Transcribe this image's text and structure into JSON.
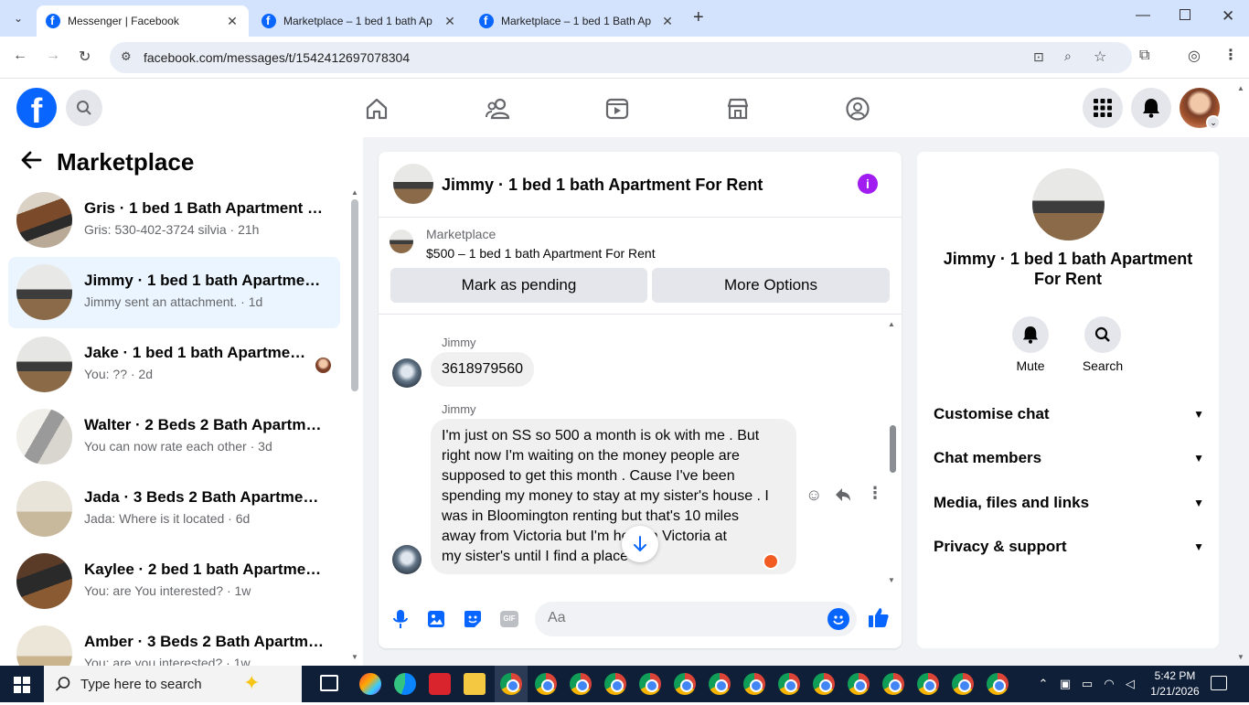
{
  "browser": {
    "tabs": [
      {
        "title": "Messenger | Facebook",
        "active": true
      },
      {
        "title": "Marketplace – 1 bed 1 bath Ap",
        "active": false
      },
      {
        "title": "Marketplace – 1 bed 1 Bath Ap",
        "active": false
      }
    ],
    "url": "facebook.com/messages/t/1542412697078304"
  },
  "left_panel": {
    "title": "Marketplace",
    "conversations": [
      {
        "name": "Gris · 1 bed 1 Bath Apartment Fo...",
        "snippet": "Gris: 530-402-3724 silvia · 21h",
        "selected": false
      },
      {
        "name": "Jimmy · 1 bed 1 bath Apartment ...",
        "snippet": "Jimmy sent an attachment. · 1d",
        "selected": true
      },
      {
        "name": "Jake · 1 bed 1 bath Apartment ...",
        "snippet": "You: ?? · 2d",
        "selected": false
      },
      {
        "name": "Walter · 2 Beds 2 Bath Apartmen...",
        "snippet": "You can now rate each other · 3d",
        "selected": false
      },
      {
        "name": "Jada · 3 Beds 2 Bath Apartment ...",
        "snippet": "Jada: Where is it located · 6d",
        "selected": false
      },
      {
        "name": "Kaylee · 2 bed 1 bath Apartment ...",
        "snippet": "You: are You interested? · 1w",
        "selected": false
      },
      {
        "name": "Amber · 3 Beds 2 Bath Apartme...",
        "snippet": "You: are you interested? · 1w",
        "selected": false
      }
    ]
  },
  "chat": {
    "title": "Jimmy · 1 bed 1 bath Apartment For Rent",
    "listing": {
      "label": "Marketplace",
      "price_title": "$500 – 1 bed 1 bath Apartment For Rent"
    },
    "buttons": {
      "pending": "Mark as pending",
      "more": "More Options"
    },
    "messages": [
      {
        "sender": "Jimmy",
        "text": "3618979560"
      },
      {
        "sender": "Jimmy",
        "lines": [
          "I'm just on SS  so 500 a month is ok with me . But",
          "right now I'm waiting on the money people are",
          "supposed to get this month . Cause I've been",
          "spending my money to stay at my sister's house . I",
          "was in Bloomington renting but that's 10 miles",
          "away from Victoria but I'm  here in Victoria at",
          "my sister's until I find a place"
        ]
      }
    ],
    "composer_placeholder": "Aa",
    "gif_label": "GIF"
  },
  "right_panel": {
    "name": "Jimmy · 1 bed 1 bath Apartment For Rent",
    "actions": [
      "Mute",
      "Search"
    ],
    "sections": [
      "Customise chat",
      "Chat members",
      "Media, files and links",
      "Privacy & support"
    ]
  },
  "taskbar": {
    "search_placeholder": "Type here to search",
    "time": "5:42 PM",
    "date": "1/21/2026"
  },
  "colors": {
    "brand": "#0866ff",
    "selected_row": "#ebf5ff",
    "info": "#a01cf0"
  }
}
